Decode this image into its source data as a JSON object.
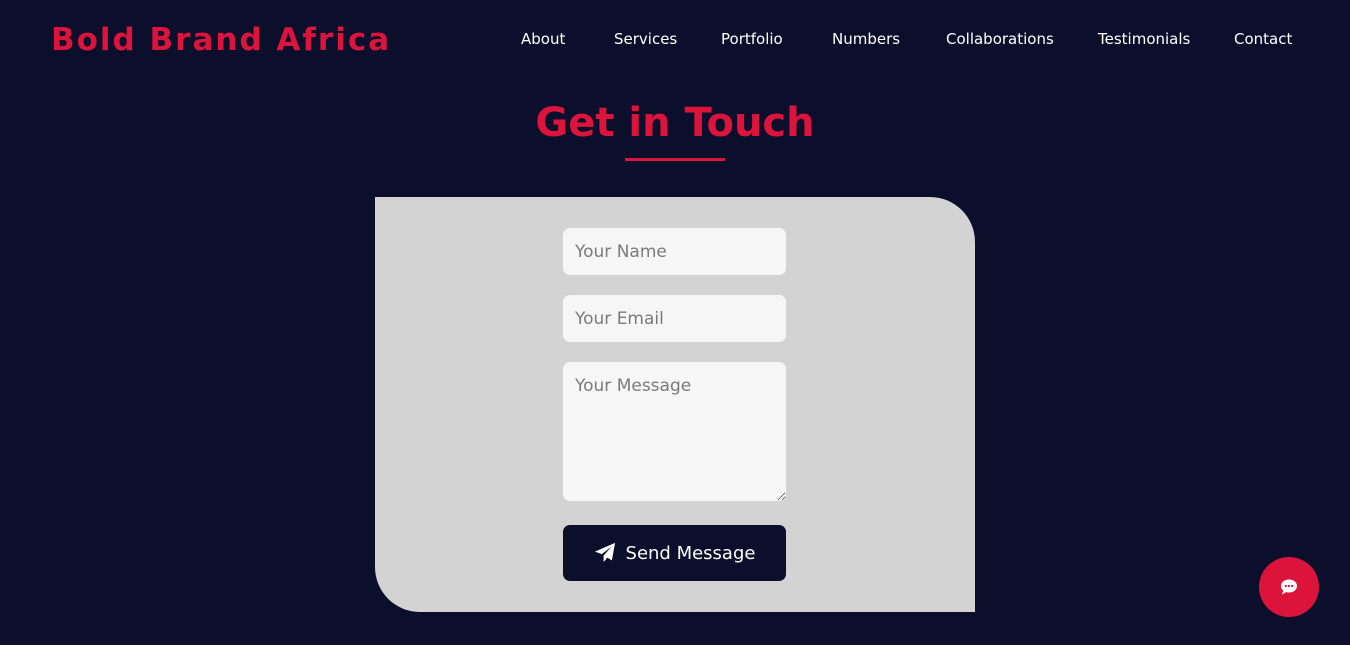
{
  "header": {
    "brand": "Bold Brand Africa",
    "nav": [
      "About",
      "Services",
      "Portfolio",
      "Numbers",
      "Collaborations",
      "Testimonials",
      "Contact"
    ]
  },
  "contact": {
    "title": "Get in Touch",
    "form": {
      "name_placeholder": "Your Name",
      "email_placeholder": "Your Email",
      "message_placeholder": "Your Message",
      "submit_label": "Send Message"
    }
  },
  "icons": {
    "send": "paper-plane-icon",
    "chat": "chat-bubble-icon"
  },
  "colors": {
    "background": "#0b0f2b",
    "accent": "#dc143c",
    "card": "#d3d3d3",
    "field": "#f6f6f6"
  }
}
